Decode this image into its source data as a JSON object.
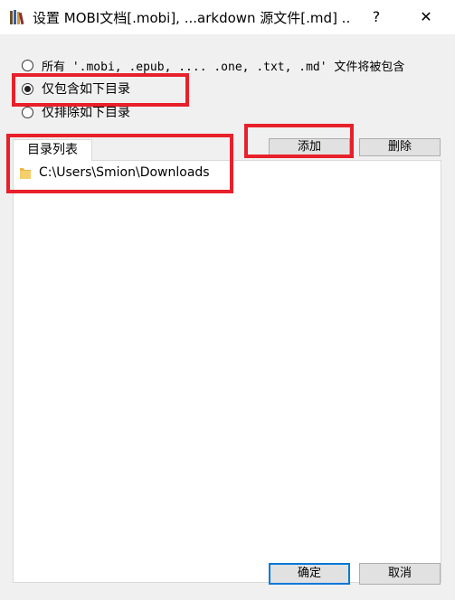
{
  "window": {
    "title": "设置 MOBI文档[.mobi], ...arkdown 源文件[.md] ...",
    "help_label": "?",
    "close_label": "✕",
    "icon": "books-icon"
  },
  "options": {
    "all_label": "所有 '.mobi, .epub, .... .one, .txt, .md' 文件将被包含",
    "include_label": "仅包含如下目录",
    "exclude_label": "仅排除如下目录",
    "selected": "include"
  },
  "directory_tab": {
    "label": "目录列表"
  },
  "toolbar": {
    "add_label": "添加",
    "delete_label": "删除"
  },
  "directories": [
    {
      "path": "C:\\Users\\Smion\\Downloads",
      "icon": "folder-icon"
    }
  ],
  "footer": {
    "ok_label": "确定",
    "cancel_label": "取消"
  },
  "colors": {
    "highlight": "#e8202a",
    "default_button_border": "#0078d7"
  }
}
